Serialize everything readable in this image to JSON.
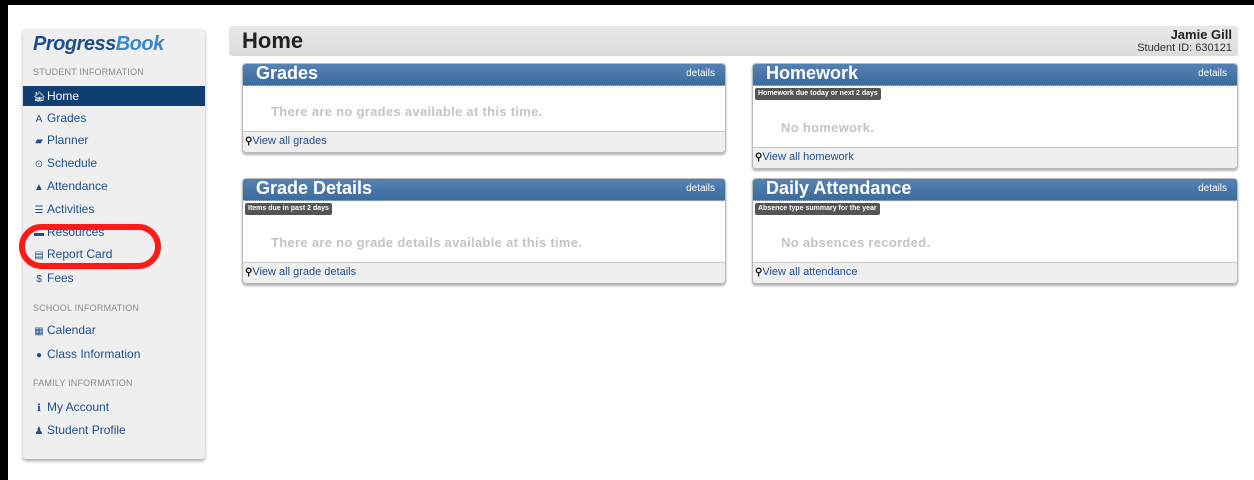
{
  "logo": {
    "text_progress": "Progress",
    "text_book": "Book"
  },
  "sidebar": {
    "sections": [
      {
        "heading": "STUDENT INFORMATION"
      },
      {
        "heading": "SCHOOL INFORMATION"
      },
      {
        "heading": "FAMILY INFORMATION"
      }
    ],
    "items": [
      {
        "label": "Home",
        "icon": "home-icon",
        "glyph": "🏠︎"
      },
      {
        "label": "Grades",
        "icon": "grades-icon",
        "glyph": "A"
      },
      {
        "label": "Planner",
        "icon": "book-icon",
        "glyph": "▰"
      },
      {
        "label": "Schedule",
        "icon": "clock-icon",
        "glyph": "⊙"
      },
      {
        "label": "Attendance",
        "icon": "bell-icon",
        "glyph": "▲"
      },
      {
        "label": "Activities",
        "icon": "list-icon",
        "glyph": "☰"
      },
      {
        "label": "Resources",
        "icon": "folder-icon",
        "glyph": "▬"
      },
      {
        "label": "Report Card",
        "icon": "report-card-icon",
        "glyph": "▤"
      },
      {
        "label": "Fees",
        "icon": "dollar-icon",
        "glyph": "$"
      },
      {
        "label": "Calendar",
        "icon": "calendar-icon",
        "glyph": "▦"
      },
      {
        "label": "Class Information",
        "icon": "comment-icon",
        "glyph": "●"
      },
      {
        "label": "My Account",
        "icon": "info-icon",
        "glyph": "ℹ"
      },
      {
        "label": "Student Profile",
        "icon": "user-icon",
        "glyph": "♟"
      }
    ]
  },
  "header": {
    "title": "Home",
    "student_name": "Jamie Gill",
    "student_id": "Student ID: 630121"
  },
  "panels": {
    "grades": {
      "title": "Grades",
      "details": "details",
      "empty": "There are no grades available at this time.",
      "link": "View all grades"
    },
    "homework": {
      "title": "Homework",
      "details": "details",
      "tag": "Homework due today or next 2 days",
      "empty": "No homework.",
      "link": "View all homework"
    },
    "grade_details": {
      "title": "Grade Details",
      "details": "details",
      "tag": "Items due in past 2 days",
      "empty": "There are no grade details available at this time.",
      "link": "View all grade details"
    },
    "daily_attendance": {
      "title": "Daily Attendance",
      "details": "details",
      "tag": "Absence type summary for the year",
      "empty": "No absences recorded.",
      "link": "View all attendance"
    }
  },
  "colors": {
    "panel_header": "#3c6b9e",
    "nav_active": "#0f3f72",
    "link": "#1d4f8c",
    "highlight": "#ff1a1a"
  }
}
